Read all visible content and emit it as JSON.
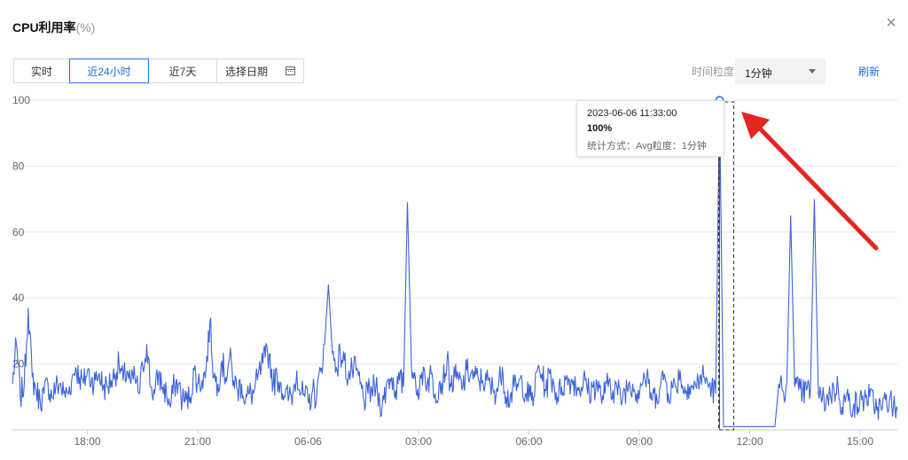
{
  "header": {
    "title": "CPU利用率",
    "unit": "(%)",
    "close_icon": "close-icon"
  },
  "toolbar": {
    "tabs": [
      {
        "label": "实时",
        "active": false
      },
      {
        "label": "近24小时",
        "active": true
      },
      {
        "label": "近7天",
        "active": false
      },
      {
        "label": "选择日期",
        "active": false,
        "icon": "calendar-icon"
      }
    ],
    "granularity_label": "时间粒度：",
    "granularity_value": "1分钟",
    "refresh_label": "刷新"
  },
  "tooltip": {
    "time": "2023-06-06 11:33:00",
    "value": "100%",
    "meta": "统计方式：Avg粒度：1分钟"
  },
  "colors": {
    "accent": "#1f6fe5",
    "line": "#3b64d9",
    "arrow": "#e52520",
    "grid": "#e6e6e6"
  },
  "chart_data": {
    "type": "line",
    "title": "CPU利用率(%)",
    "x_tick_labels": [
      "18:00",
      "21:00",
      "06-06",
      "03:00",
      "06:00",
      "09:00",
      "12:00",
      "15:00"
    ],
    "y_ticks": [
      20,
      40,
      60,
      80,
      100
    ],
    "ylim": [
      0,
      100
    ],
    "grid": true,
    "series": [
      {
        "values": [
          14,
          26,
          10,
          14,
          37,
          16,
          12,
          9,
          11,
          14,
          10,
          13,
          14,
          11,
          11,
          15,
          19,
          16,
          14,
          18,
          15,
          15,
          17,
          13,
          13,
          15,
          17,
          20,
          15,
          18,
          14,
          16,
          11,
          19,
          26,
          13,
          11,
          17,
          13,
          11,
          7,
          14,
          14,
          9,
          9,
          10,
          18,
          14,
          15,
          18,
          33,
          16,
          14,
          21,
          16,
          22,
          15,
          12,
          14,
          9,
          11,
          11,
          15,
          19,
          22,
          23,
          14,
          16,
          14,
          10,
          10,
          11,
          18,
          11,
          10,
          8,
          12,
          10,
          18,
          26,
          44,
          23,
          19,
          23,
          21,
          16,
          18,
          18,
          14,
          9,
          11,
          12,
          13,
          8,
          9,
          15,
          16,
          12,
          15,
          13,
          69,
          19,
          16,
          11,
          19,
          14,
          17,
          11,
          14,
          15,
          21,
          13,
          16,
          15,
          13,
          18,
          17,
          16,
          15,
          15,
          15,
          13,
          12,
          13,
          19,
          10,
          10,
          13,
          13,
          15,
          11,
          10,
          10,
          19,
          17,
          12,
          17,
          14,
          10,
          13,
          15,
          15,
          15,
          13,
          13,
          15,
          11,
          13,
          14,
          10,
          11,
          15,
          12,
          13,
          9,
          12,
          14,
          14,
          11,
          14,
          16,
          14,
          9,
          11,
          13,
          17,
          11,
          13,
          13,
          18,
          11,
          14,
          13,
          13,
          16,
          16,
          14,
          13,
          11,
          100,
          1,
          1,
          1,
          1,
          1,
          1,
          1,
          1,
          1,
          1,
          1,
          1,
          1,
          1,
          14,
          12,
          14,
          65,
          13,
          12,
          11,
          12,
          12,
          70,
          11,
          9,
          9,
          11,
          12,
          13,
          7,
          10,
          8,
          8,
          7,
          9,
          10,
          10,
          8,
          7,
          6,
          9,
          9,
          7,
          6
        ]
      }
    ]
  }
}
